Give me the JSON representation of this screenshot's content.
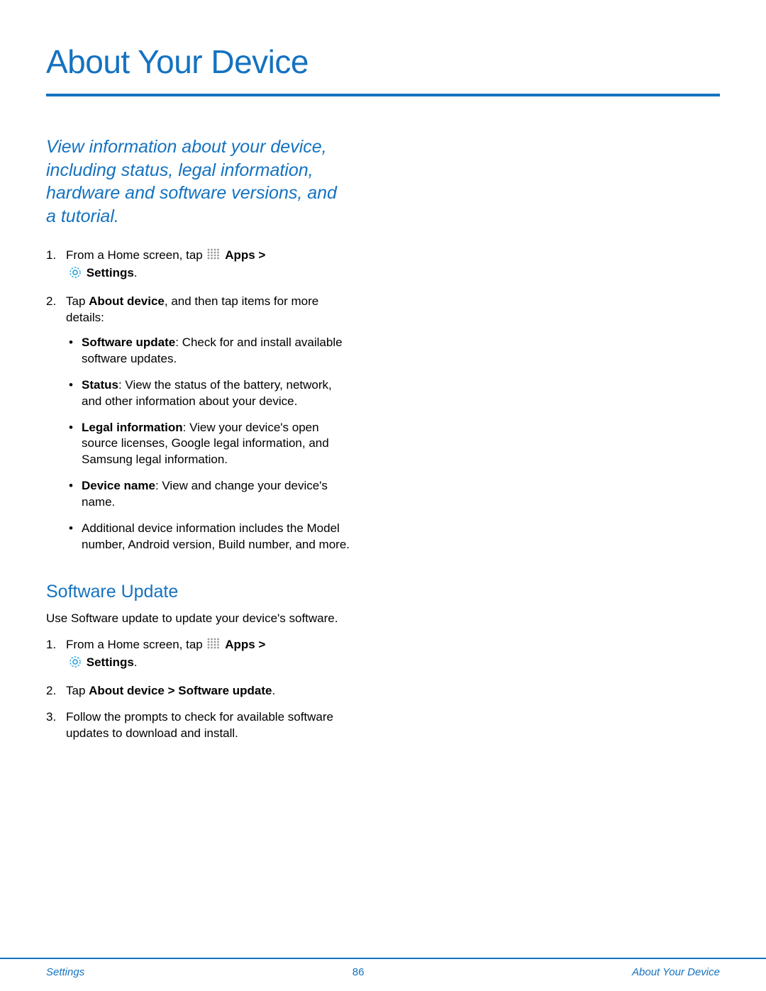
{
  "title": "About Your Device",
  "intro": "View information about your device, including status, legal information, hardware and software versions, and a tutorial.",
  "steps1": {
    "s1_prefix": "From a Home screen, tap ",
    "apps_label": "Apps",
    "gt": " > ",
    "settings_label": "Settings",
    "period": ".",
    "s2_prefix": "Tap ",
    "s2_bold": "About device",
    "s2_suffix": ", and then tap items for more details:",
    "bullets": [
      {
        "bold": "Software update",
        "rest": ": Check for and install available software updates."
      },
      {
        "bold": "Status",
        "rest": ": View the status of the battery, network, and other information about your device."
      },
      {
        "bold": "Legal information",
        "rest": ": View your device's open source licenses, Google legal information, and Samsung legal information."
      },
      {
        "bold": "Device name",
        "rest": ": View and change your device's name."
      },
      {
        "bold": "",
        "rest": "Additional device information includes the Model number, Android version, Build number, and more."
      }
    ]
  },
  "section2": {
    "heading": "Software Update",
    "intro": "Use Software update to update your device's software.",
    "s1_prefix": "From a Home screen, tap ",
    "apps_label": "Apps",
    "gt": " > ",
    "settings_label": "Settings",
    "period": ".",
    "s2_prefix": "Tap ",
    "s2_bold": "About device > Software update",
    "s2_suffix": ".",
    "s3": "Follow the prompts to check for available software updates to download and install."
  },
  "footer": {
    "left": "Settings",
    "center": "86",
    "right": "About Your Device"
  }
}
